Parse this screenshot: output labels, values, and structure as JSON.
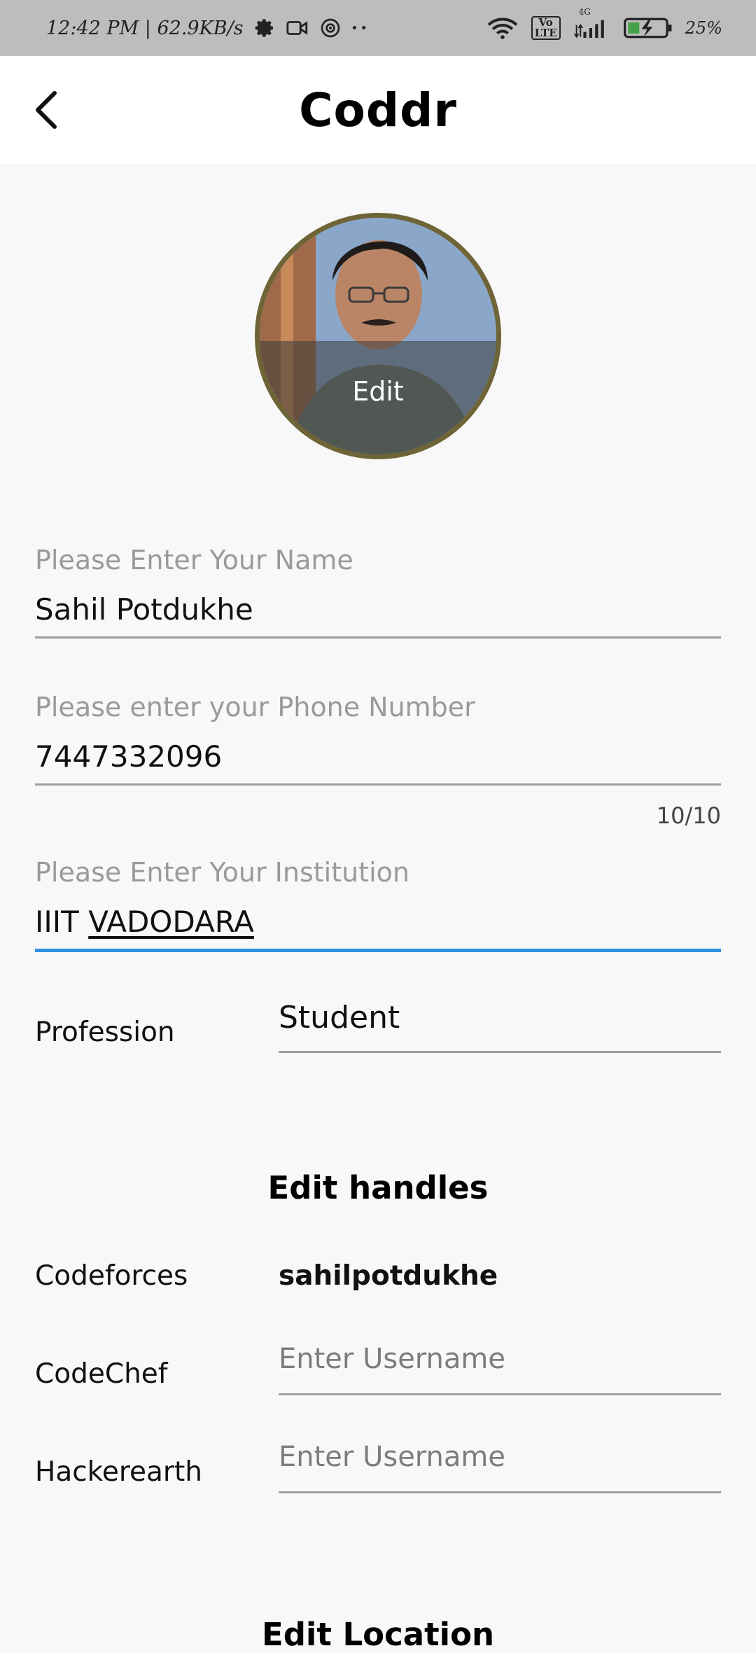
{
  "status_bar": {
    "time_speed": "12:42 PM | 62.9KB/s",
    "network_badge_1": "Vo",
    "network_badge_2": "LTE",
    "network_gen": "4G",
    "battery": "25%"
  },
  "app_bar": {
    "title": "Coddr",
    "back_icon": "arrow-back-icon"
  },
  "avatar": {
    "edit_label": "Edit",
    "ring_color": "#6e6436"
  },
  "form": {
    "name": {
      "label": "Please Enter Your Name",
      "value": "Sahil Potdukhe"
    },
    "phone": {
      "label": "Please enter your Phone Number",
      "value": "7447332096",
      "counter": "10/10"
    },
    "institution": {
      "label": "Please Enter Your Institution",
      "value_prefix": "IIIT",
      "value_underlined": "VADODARA",
      "focus_color": "#2e8ee0"
    },
    "profession": {
      "label": "Profession",
      "value": "Student"
    }
  },
  "handles": {
    "title": "Edit handles",
    "codeforces": {
      "label": "Codeforces",
      "value": "sahilpotdukhe"
    },
    "codechef": {
      "label": "CodeChef",
      "placeholder": "Enter Username"
    },
    "hackerearth": {
      "label": "Hackerearth",
      "placeholder": "Enter Username"
    }
  },
  "location": {
    "title": "Edit Location"
  }
}
